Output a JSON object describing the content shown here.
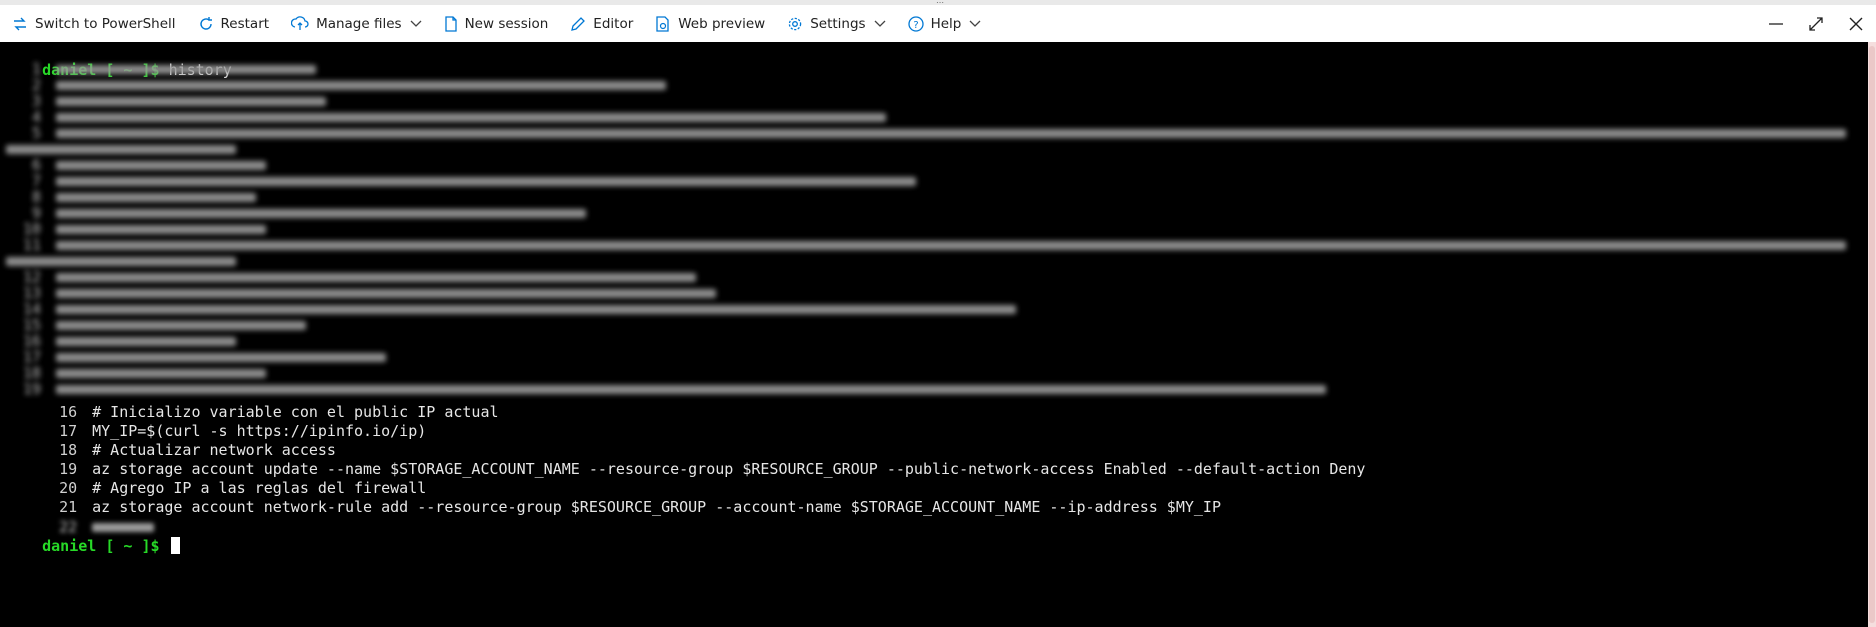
{
  "toolbar": {
    "switch_label": "Switch to PowerShell",
    "restart_label": "Restart",
    "manage_files_label": "Manage files",
    "new_session_label": "New session",
    "editor_label": "Editor",
    "web_preview_label": "Web preview",
    "settings_label": "Settings",
    "help_label": "Help"
  },
  "terminal": {
    "prompt": "daniel [ ~ ]$",
    "command": "history",
    "visible_lines": [
      {
        "num": "16",
        "text": "# Inicializo variable con el public IP actual"
      },
      {
        "num": "17",
        "text": "MY_IP=$(curl -s https://ipinfo.io/ip)"
      },
      {
        "num": "18",
        "text": "# Actualizar network access"
      },
      {
        "num": "19",
        "text": "az storage account update --name $STORAGE_ACCOUNT_NAME --resource-group $RESOURCE_GROUP --public-network-access Enabled --default-action Deny"
      },
      {
        "num": "20",
        "text": "# Agrego IP a las reglas del firewall"
      },
      {
        "num": "21",
        "text": "az storage account network-rule add --resource-group $RESOURCE_GROUP --account-name $STORAGE_ACCOUNT_NAME --ip-address $MY_IP"
      }
    ],
    "final_prompt": "daniel [ ~ ]$"
  },
  "colors": {
    "prompt": "#27d927",
    "background": "#000000",
    "text": "#e6e6e6",
    "accent": "#0078d4"
  }
}
